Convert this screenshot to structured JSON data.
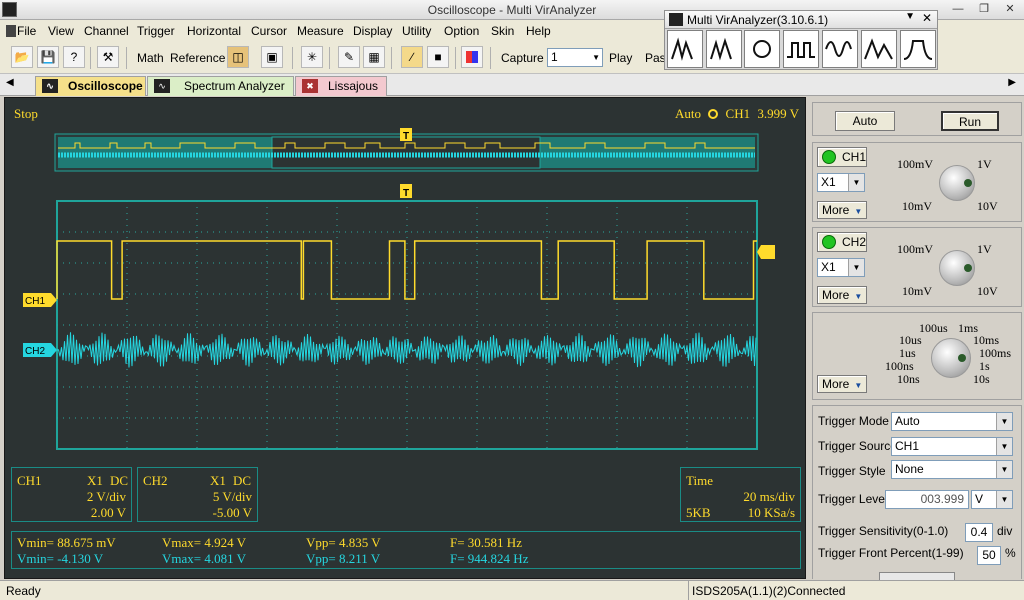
{
  "window": {
    "title": "Oscilloscope - Multi VirAnalyzer"
  },
  "menu": [
    "File",
    "View",
    "Channel",
    "Trigger",
    "Horizontal",
    "Cursor",
    "Measure",
    "Display",
    "Utility",
    "Option",
    "Skin",
    "Help"
  ],
  "toolbar": {
    "math_label": "Math",
    "reference_label": "Reference",
    "capture_label": "Capture",
    "capture_value": "1",
    "play_label": "Play",
    "pause_label": "Pas"
  },
  "popup": {
    "title": "Multi VirAnalyzer(3.10.6.1)"
  },
  "tabs": [
    "Oscilloscope",
    "Spectrum Analyzer",
    "Lissajous"
  ],
  "scope": {
    "status": "Stop",
    "trigger_mode": "Auto",
    "trigger_channel": "CH1",
    "trigger_value": "3.999 V",
    "trigger_marker": "T",
    "ch1_marker": "CH1",
    "ch2_marker": "CH2"
  },
  "ch1_info": {
    "name": "CH1",
    "probe": "X1",
    "coupling": "DC",
    "scale": "2 V/div",
    "offset": "2.00 V"
  },
  "ch2_info": {
    "name": "CH2",
    "probe": "X1",
    "coupling": "DC",
    "scale": "5 V/div",
    "offset": "-5.00 V"
  },
  "time_info": {
    "label": "Time",
    "scale": "20 ms/div",
    "depth": "5KB",
    "rate": "10 KSa/s"
  },
  "measurements": {
    "ch1": {
      "vmin": "Vmin= 88.675 mV",
      "vmax": "Vmax= 4.924 V",
      "vpp": "Vpp= 4.835 V",
      "freq": "F= 30.581 Hz"
    },
    "ch2": {
      "vmin": "Vmin= -4.130 V",
      "vmax": "Vmax= 4.081 V",
      "vpp": "Vpp= 8.211 V",
      "freq": "F= 944.824 Hz"
    }
  },
  "controls": {
    "auto_label": "Auto",
    "run_label": "Run",
    "ch1": {
      "label": "CH1",
      "probe": "X1",
      "more": "More",
      "knob_labels": [
        "100mV",
        "1V",
        "10mV",
        "10V"
      ]
    },
    "ch2": {
      "label": "CH2",
      "probe": "X1",
      "more": "More",
      "knob_labels": [
        "100mV",
        "1V",
        "10mV",
        "10V"
      ]
    },
    "timebase": {
      "more": "More",
      "knob_labels": [
        "100us",
        "1ms",
        "10us",
        "10ms",
        "1us",
        "100ms",
        "100ns",
        "1s",
        "10ns",
        "10s"
      ]
    },
    "trigger": {
      "mode_label": "Trigger Mode",
      "mode_value": "Auto",
      "source_label": "Trigger Source",
      "source_value": "CH1",
      "style_label": "Trigger Style",
      "style_value": "None",
      "level_label": "Trigger Level",
      "level_value": "003.999",
      "level_unit": "V",
      "sensitivity_label": "Trigger Sensitivity(0-1.0)",
      "sensitivity_value": "0.4",
      "sensitivity_unit": "div",
      "front_label": "Trigger Front Percent(1-99)",
      "front_value": "50",
      "front_unit": "%"
    }
  },
  "status": {
    "left": "Ready",
    "right": "ISDS205A(1.1)(2)Connected"
  },
  "colors": {
    "ch1": "#ffdb2c",
    "ch2": "#25d6e0",
    "screen": "#2c3333",
    "grid_border": "#1fa59b"
  },
  "ch1_wave_edges": [
    0.0,
    0.078,
    0.093,
    0.349,
    0.352,
    0.392,
    0.475,
    0.497,
    0.511,
    0.692,
    0.716,
    0.796,
    0.843,
    0.924,
    0.995
  ]
}
